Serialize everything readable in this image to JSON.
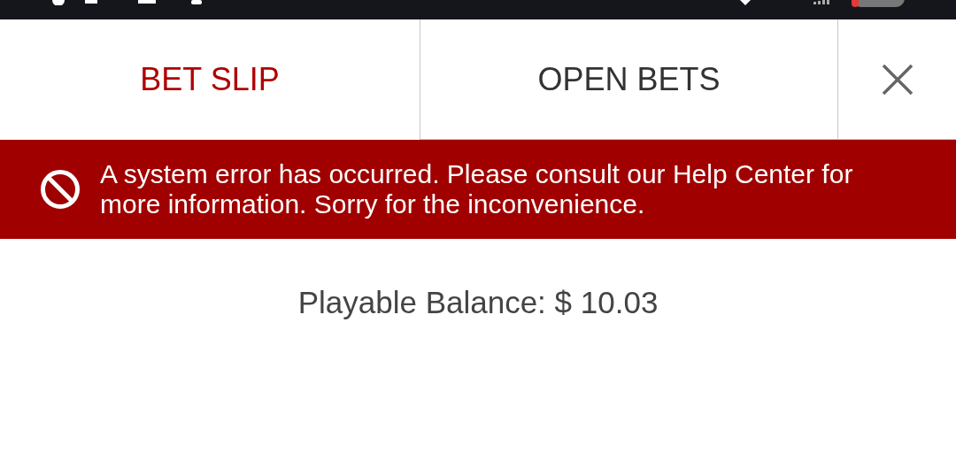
{
  "tabs": [
    {
      "label": "BET SLIP",
      "selected": true
    },
    {
      "label": "OPEN BETS",
      "selected": false
    }
  ],
  "error_banner": {
    "message": "A system error has occurred. Please consult our Help Center for more information. Sorry for the inconvenience."
  },
  "balance": {
    "label": "Playable Balance: $ 10.03"
  }
}
